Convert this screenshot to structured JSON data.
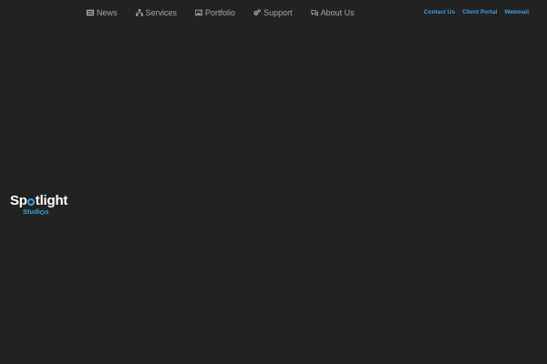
{
  "main_nav": {
    "items": [
      {
        "label": "News",
        "icon": "newspaper-icon"
      },
      {
        "label": "Services",
        "icon": "sitemap-icon"
      },
      {
        "label": "Portfolio",
        "icon": "image-icon"
      },
      {
        "label": "Support",
        "icon": "gears-icon"
      },
      {
        "label": "About Us",
        "icon": "comments-icon"
      }
    ]
  },
  "util_nav": {
    "contact": "Contact Us",
    "portal": "Client Portal",
    "webmail": "Webmail"
  },
  "logo": {
    "word_start": "Sp",
    "word_end": "tlight",
    "sub_start": "Studi",
    "sub_end": "s"
  },
  "colors": {
    "background": "#222222",
    "nav_text": "#a7a7a7",
    "accent": "#3f9fdb",
    "logo_text": "#ffffff"
  }
}
